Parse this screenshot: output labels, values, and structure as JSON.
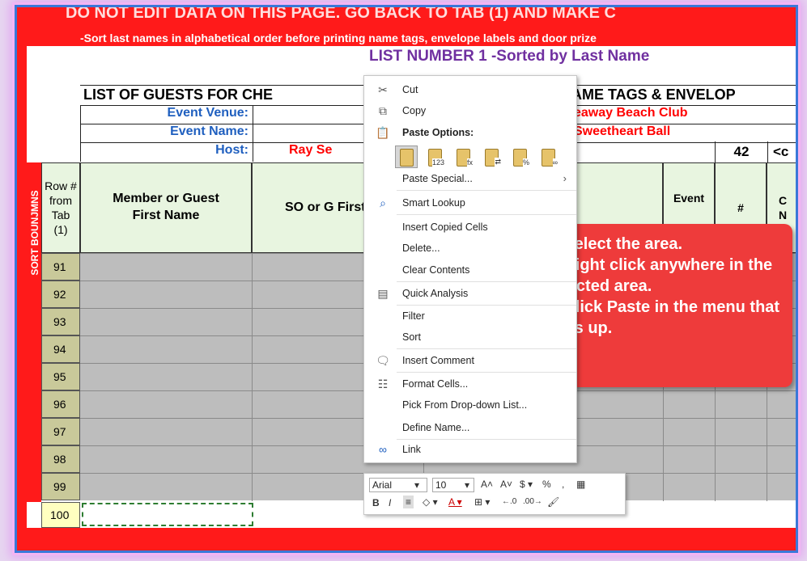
{
  "header": {
    "warning": "DO NOT EDIT DATA ON THIS PAGE. GO BACK TO TAB (1) AND MAKE C",
    "sort_note": "-Sort last names in alphabetical order before printing name tags, envelope labels and door prize",
    "list_title": "LIST NUMBER 1 -Sorted by Last Name",
    "guests_title": "LIST OF GUESTS FOR CHE",
    "nametags_title": "NAME TAGS & ENVELOP"
  },
  "event": {
    "venue_label": "Event Venue:",
    "venue_value": "eaway Beach Club",
    "name_label": "Event Name:",
    "name_value": "Sweetheart Ball",
    "host_label": "Host:",
    "host_value": "Ray Se",
    "count": "42",
    "count_next": "<c"
  },
  "sort_column_label": "SORT BOUNJMNS",
  "columns": {
    "row_num": "Row # from Tab (1)",
    "member_first": "Member or Guest First Name",
    "so_first": "SO or G First N",
    "event": "Event",
    "hash": "#",
    "c": "C",
    "n": "N"
  },
  "rows": [
    "91",
    "92",
    "93",
    "94",
    "95",
    "96",
    "97",
    "98",
    "99"
  ],
  "row_last": "100",
  "context_menu": {
    "cut": "Cut",
    "copy": "Copy",
    "paste_options": "Paste Options:",
    "paste_special": "Paste Special...",
    "smart_lookup": "Smart Lookup",
    "insert_copied": "Insert Copied Cells",
    "delete": "Delete...",
    "clear": "Clear Contents",
    "quick_analysis": "Quick Analysis",
    "filter": "Filter",
    "sort": "Sort",
    "insert_comment": "Insert Comment",
    "format_cells": "Format Cells...",
    "pick_list": "Pick From Drop-down List...",
    "define_name": "Define Name...",
    "link": "Link"
  },
  "mini_toolbar": {
    "font": "Arial",
    "size": "10"
  },
  "callout": {
    "text": "1) Select the area.\n2) Right click anywhere in the selected area.\n3) Click Paste in the menu that pops up."
  },
  "colors": {
    "red": "#ff1a1a",
    "callout": "#ee3b3b",
    "blue_label": "#1f5fbf",
    "purple_title": "#7030a0"
  }
}
